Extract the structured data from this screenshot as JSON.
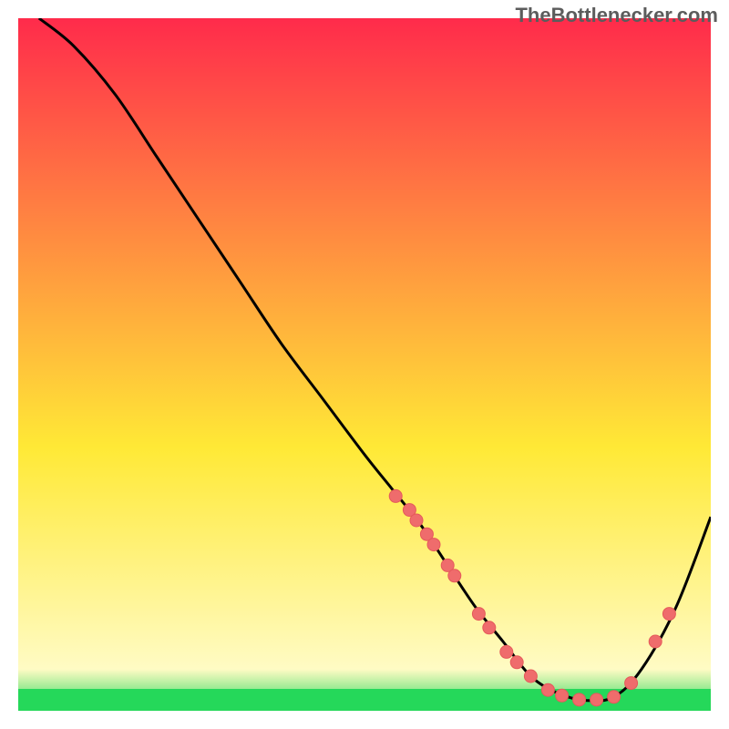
{
  "watermark": "TheBottlenecker.com",
  "colors": {
    "curve": "#000000",
    "dot_fill": "#ef6c6c",
    "dot_stroke": "#e55a5a",
    "green_band": "#25d85a",
    "gradient_top": "#ff2b4b",
    "gradient_mid": "#ffe936",
    "gradient_low": "#fffbc4"
  },
  "chart_data": {
    "type": "line",
    "title": "",
    "xlabel": "",
    "ylabel": "",
    "xlim": [
      0,
      100
    ],
    "ylim": [
      0,
      100
    ],
    "curve": {
      "x": [
        3,
        8,
        14,
        20,
        26,
        32,
        38,
        44,
        50,
        54,
        58,
        62,
        66,
        70,
        74,
        78,
        82,
        86,
        90,
        95,
        100
      ],
      "y": [
        100,
        96,
        89,
        80,
        71,
        62,
        53,
        45,
        37,
        32,
        27,
        21,
        15,
        10,
        5,
        2.5,
        1.5,
        2,
        6,
        15,
        28
      ]
    },
    "dots": [
      {
        "x": 54.5,
        "y": 31
      },
      {
        "x": 56.5,
        "y": 29
      },
      {
        "x": 57.5,
        "y": 27.5
      },
      {
        "x": 59,
        "y": 25.5
      },
      {
        "x": 60,
        "y": 24
      },
      {
        "x": 62,
        "y": 21
      },
      {
        "x": 63,
        "y": 19.5
      },
      {
        "x": 66.5,
        "y": 14
      },
      {
        "x": 68,
        "y": 12
      },
      {
        "x": 70.5,
        "y": 8.5
      },
      {
        "x": 72,
        "y": 7
      },
      {
        "x": 74,
        "y": 5
      },
      {
        "x": 76.5,
        "y": 3
      },
      {
        "x": 78.5,
        "y": 2.2
      },
      {
        "x": 81,
        "y": 1.6
      },
      {
        "x": 83.5,
        "y": 1.6
      },
      {
        "x": 86,
        "y": 2
      },
      {
        "x": 88.5,
        "y": 4
      },
      {
        "x": 92,
        "y": 10
      },
      {
        "x": 94,
        "y": 14
      }
    ]
  }
}
